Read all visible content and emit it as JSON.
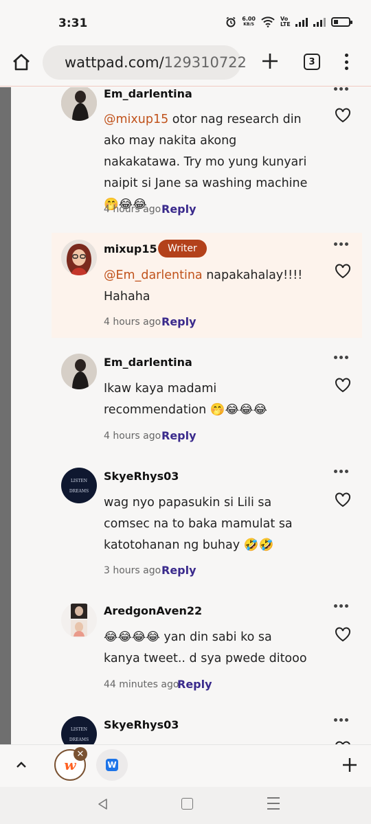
{
  "status_bar": {
    "time": "3:31",
    "net_speed_value": "6.00",
    "net_speed_unit": "KB/S",
    "volte": "Vo LTE",
    "battery_level": 0.2
  },
  "browser": {
    "url_domain": "wattpad.com/",
    "url_path": "129310722",
    "tab_count": "3"
  },
  "comments": [
    {
      "username": "Em_darlentina",
      "writer": false,
      "mention": "@mixup15",
      "text": " otor nag research din ako may nakita akong nakakatawa. Try mo yung kunyari naipit si Jane sa washing machine 🤭😂😂",
      "time": "4 hours ago",
      "reply": "Reply"
    },
    {
      "username": "mixup15",
      "writer": true,
      "badge": "Writer",
      "mention": "@Em_darlentina",
      "text": " napakahalay!!!! Hahaha",
      "time": "4 hours ago",
      "reply": "Reply"
    },
    {
      "username": "Em_darlentina",
      "writer": false,
      "mention": "",
      "text": "Ikaw kaya madami recommendation 🤭😂😂😂",
      "time": "4 hours ago",
      "reply": "Reply"
    },
    {
      "username": "SkyeRhys03",
      "writer": false,
      "mention": "",
      "text": "wag nyo papasukin si Lili sa comsec na to baka mamulat sa katotohanan ng buhay 🤣🤣",
      "time": "3 hours ago",
      "reply": "Reply"
    },
    {
      "username": "AredgonAven22",
      "writer": false,
      "mention": "",
      "text": "😂😂😂😂 yan din sabi ko sa kanya tweet.. d sya pwede ditooo",
      "time": "44 minutes ago",
      "reply": "Reply"
    },
    {
      "username": "SkyeRhys03",
      "writer": false,
      "mention": "",
      "text": "",
      "time": "",
      "reply": ""
    }
  ],
  "avatar_texts": {
    "skye_line1": "LISTEN",
    "skye_line2": "DREAMS"
  },
  "tab_strip": {
    "wattpad_letter": "w",
    "close_symbol": "✕",
    "second_tab_letter": "W"
  },
  "colors": {
    "mention": "#c0521b",
    "reply": "#3a2a8c",
    "writer_badge": "#b3411b",
    "highlight_bg": "#fdf3ec",
    "wattpad_orange": "#ff6122"
  }
}
